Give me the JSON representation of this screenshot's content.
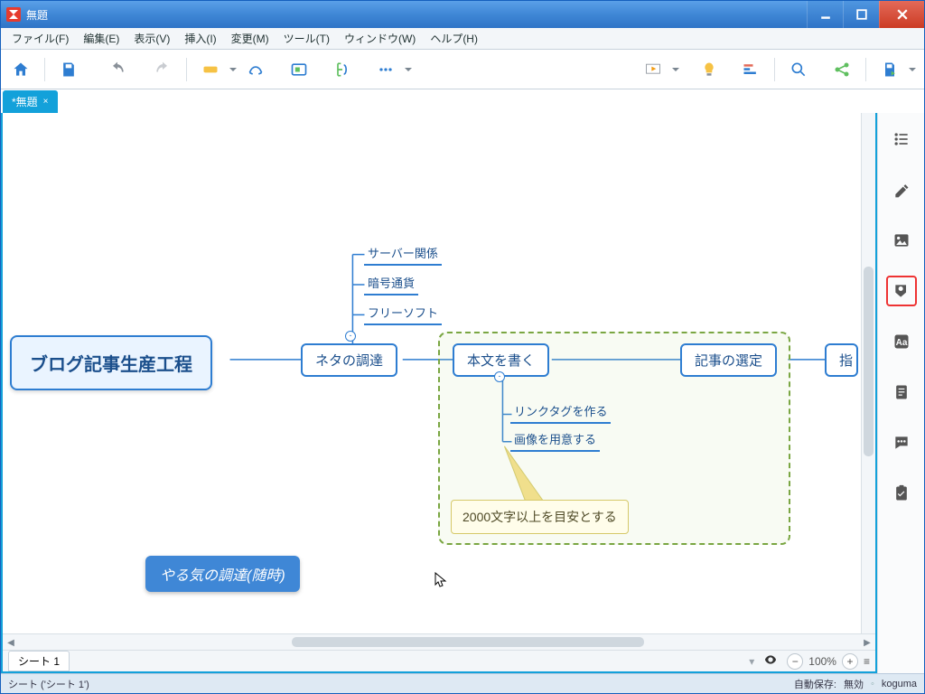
{
  "window": {
    "title": "無題"
  },
  "menus": {
    "file": "ファイル(F)",
    "edit": "編集(E)",
    "view": "表示(V)",
    "insert": "挿入(I)",
    "modify": "変更(M)",
    "tools": "ツール(T)",
    "window": "ウィンドウ(W)",
    "help": "ヘルプ(H)"
  },
  "doctab": {
    "label": "*無題",
    "close": "×"
  },
  "mindmap": {
    "root": "ブログ記事生産工程",
    "n1": "ネタの調達",
    "n1_children": {
      "a": "サーバー関係",
      "b": "暗号通貨",
      "c": "フリーソフト"
    },
    "n2": "本文を書く",
    "n2_children": {
      "a": "リンクタグを作る",
      "b": "画像を用意する"
    },
    "n2_callout": "2000文字以上を目安とする",
    "n3": "記事の選定",
    "n4": "指",
    "floating": "やる気の調達(随時)"
  },
  "sheet": {
    "tab": "シート 1",
    "zoom": "100%"
  },
  "status": {
    "left": "シート ('シート 1')",
    "autosave_label": "自動保存:",
    "autosave_value": "無効",
    "user": "koguma"
  }
}
